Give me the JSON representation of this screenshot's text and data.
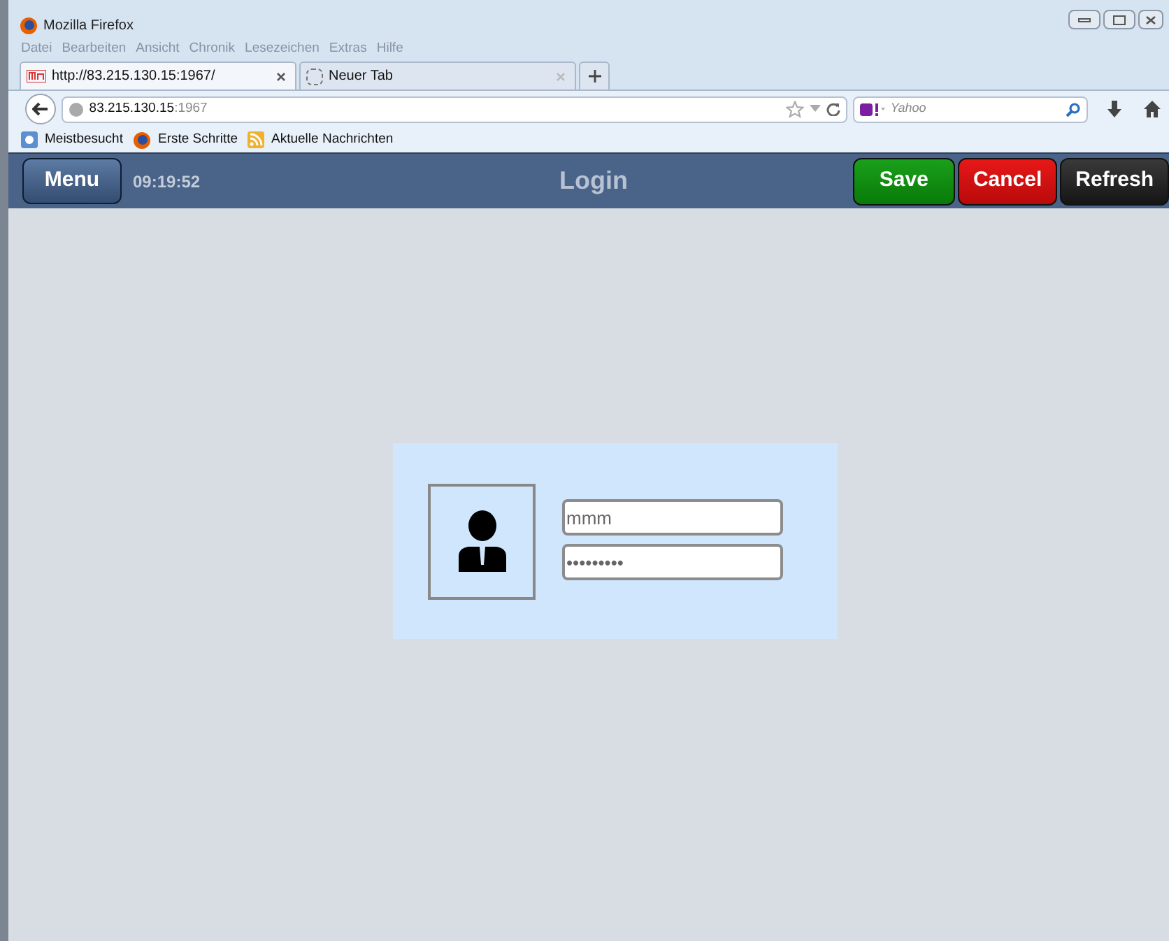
{
  "window": {
    "title": "Mozilla Firefox"
  },
  "menu_bar": [
    "Datei",
    "Bearbeiten",
    "Ansicht",
    "Chronik",
    "Lesezeichen",
    "Extras",
    "Hilfe"
  ],
  "tabs": [
    {
      "label": "http://83.215.130.15:1967/",
      "selected": true
    },
    {
      "label": "Neuer Tab",
      "selected": false
    }
  ],
  "address_bar": {
    "host": "83.215.130.15",
    "port": ":1967"
  },
  "search": {
    "placeholder": "Yahoo"
  },
  "bookmarks": [
    {
      "label": "Meistbesucht",
      "kind": "folder"
    },
    {
      "label": "Erste Schritte",
      "kind": "firefox"
    },
    {
      "label": "Aktuelle Nachrichten",
      "kind": "feed"
    }
  ],
  "app_header": {
    "menu_button": "Menu",
    "time": "09:19:52",
    "title": "Login",
    "buttons": [
      {
        "label": "Save",
        "kind": "save"
      },
      {
        "label": "Cancel",
        "kind": "cancel"
      },
      {
        "label": "Refresh",
        "kind": "refresh"
      }
    ]
  },
  "login": {
    "username": "mmm",
    "password": "•••••••••"
  }
}
